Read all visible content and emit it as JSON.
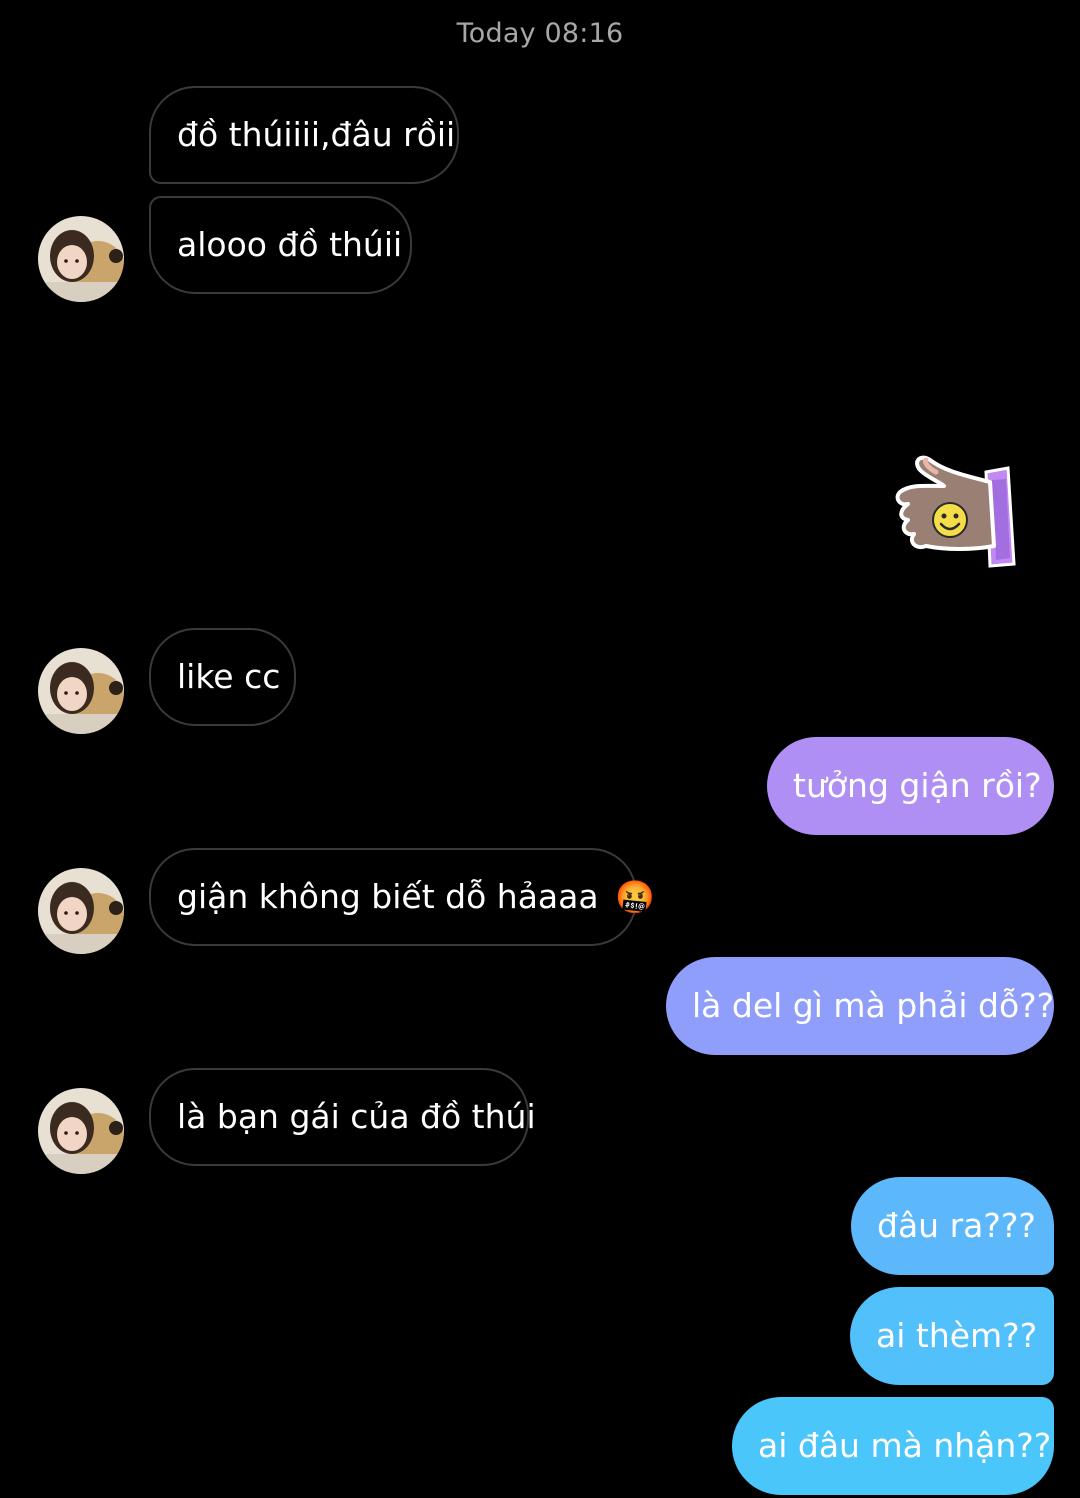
{
  "header": {
    "timestamp": "Today 08:16"
  },
  "messages": [
    {
      "direction": "in",
      "text": "đồ thúiiii,đâu rồii"
    },
    {
      "direction": "in",
      "text": "alooo đồ thúii"
    },
    {
      "direction": "out",
      "type": "sticker",
      "sticker": "hand-smiley-sticker"
    },
    {
      "direction": "in",
      "text": "like cc"
    },
    {
      "direction": "out",
      "text": "tưởng giận rồi?"
    },
    {
      "direction": "in",
      "text": "giận không biết dỗ hảaaa",
      "emoji": "🤬"
    },
    {
      "direction": "out",
      "text": "là del gì mà phải dỗ??"
    },
    {
      "direction": "in",
      "text": "là bạn gái của đồ thúi"
    },
    {
      "direction": "out",
      "text": "đâu ra???"
    },
    {
      "direction": "out",
      "text": "ai thèm??"
    },
    {
      "direction": "out",
      "text": "ai đâu mà nhận??"
    }
  ],
  "colors": {
    "background": "#000000",
    "incoming_border": "#3a3a3a",
    "gradient_top": "#b38cf5",
    "gradient_mid": "#8f9cfb",
    "gradient_bottom": "#4fc5fb"
  }
}
